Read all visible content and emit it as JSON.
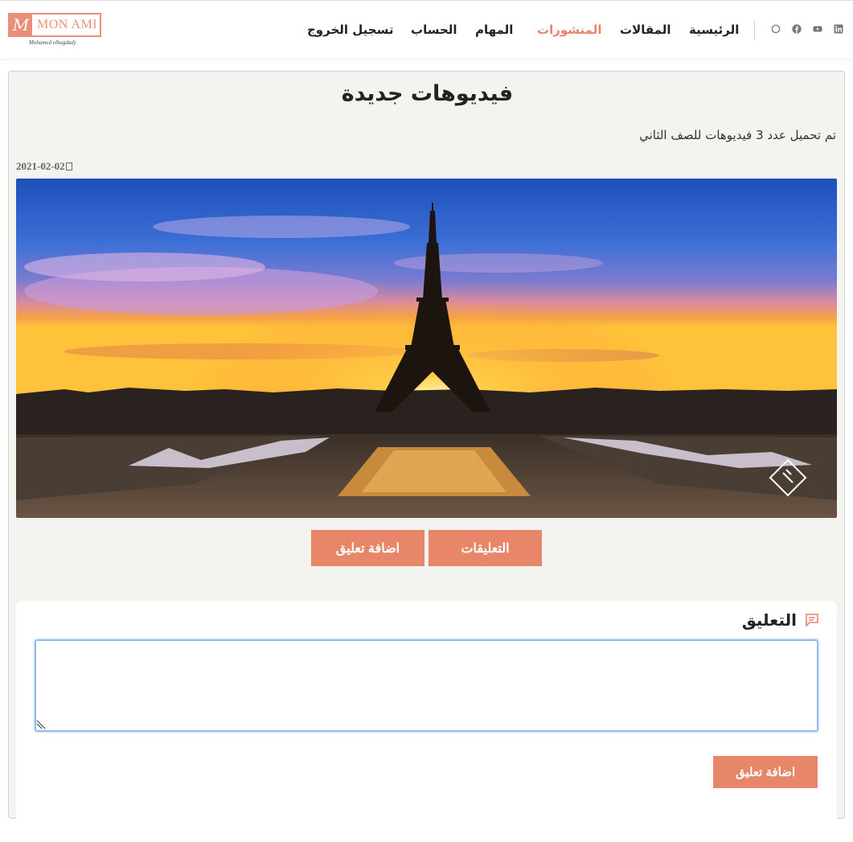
{
  "header": {
    "logo": {
      "mark": "M",
      "text": "MON AMI",
      "subtitle": "Mohamed elbagdady"
    },
    "nav": [
      {
        "label": "الرئيسية",
        "active": false
      },
      {
        "label": "المقالات",
        "active": false
      },
      {
        "label": "المنشورات",
        "active": true
      },
      {
        "label": "المهام",
        "active": false
      },
      {
        "label": "الحساب",
        "active": false
      },
      {
        "label": "تسجيل الخروج",
        "active": false
      }
    ],
    "social_icons": [
      "whatsapp-icon",
      "facebook-icon",
      "youtube-icon",
      "linkedin-icon"
    ],
    "accent_color": "#e8836a"
  },
  "post": {
    "title": "فيديوهات جديدة",
    "body": "تم تحميل عدد 3 فيديوهات للصف الثاني",
    "date": "2021-02-02",
    "image_subject": "eiffel-tower-sunset"
  },
  "actions": {
    "comments_label": "التعليقات",
    "add_comment_label": "اضافة تعليق"
  },
  "comment_form": {
    "title": "التعليق",
    "input_value": "",
    "submit_label": "اضافة تعليق"
  }
}
